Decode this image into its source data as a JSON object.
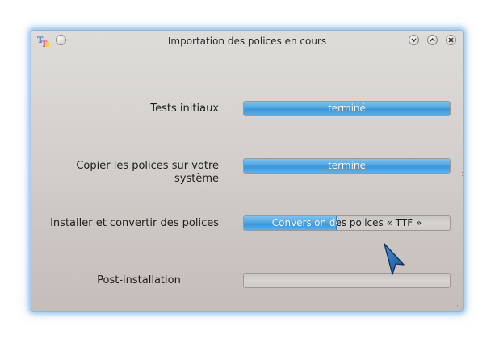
{
  "window": {
    "title": "Importation des polices en cours",
    "accent_color": "#4ea6e2"
  },
  "titlebar": {
    "app_icon": "tt-font-icon",
    "menu_button": "window-menu-icon",
    "buttons": [
      "minimize-icon",
      "maximize-icon",
      "close-icon"
    ]
  },
  "steps": [
    {
      "label": "Tests initiaux",
      "status": "terminé",
      "progress": 1.0
    },
    {
      "label": "Copier les polices sur votre système",
      "status": "terminé",
      "progress": 1.0
    },
    {
      "label": "Installer et convertir des polices",
      "status": "Conversion des polices « TTF »",
      "progress": 0.45
    },
    {
      "label": "Post-installation",
      "status": "",
      "progress": 0.0
    }
  ]
}
